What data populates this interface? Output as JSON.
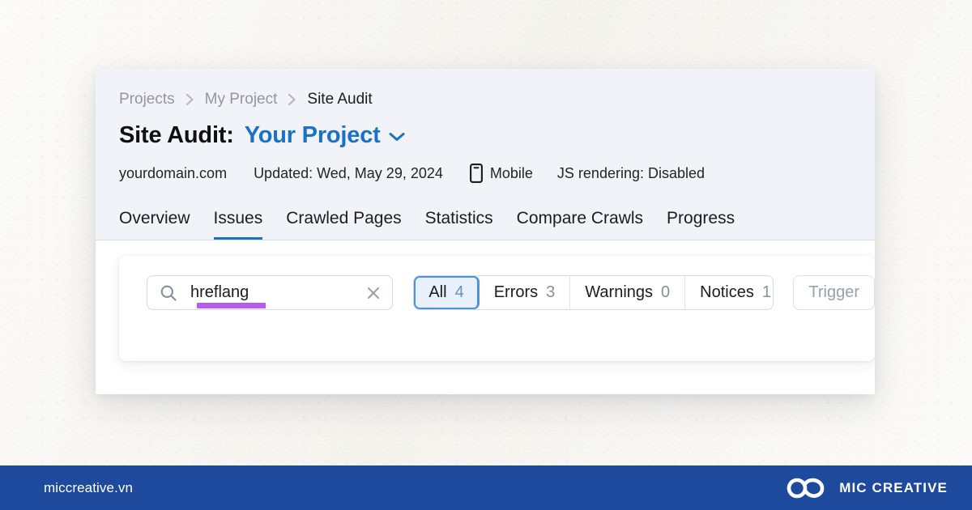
{
  "breadcrumb": {
    "items": [
      {
        "label": "Projects"
      },
      {
        "label": "My Project"
      },
      {
        "label": "Site Audit"
      }
    ],
    "separator_icon": "chevron-right-icon"
  },
  "header": {
    "title_static": "Site Audit:",
    "title_project": "Your Project",
    "project_dropdown_icon": "chevron-down-icon",
    "accent_blue": "#1a72c4"
  },
  "meta": {
    "domain": "yourdomain.com",
    "updated": "Updated: Wed, May 29, 2024",
    "device_icon": "mobile-phone-icon",
    "device": "Mobile",
    "js_rendering": "JS rendering: Disabled"
  },
  "tabs": [
    {
      "label": "Overview",
      "active": false
    },
    {
      "label": "Issues",
      "active": true
    },
    {
      "label": "Crawled Pages",
      "active": false
    },
    {
      "label": "Statistics",
      "active": false
    },
    {
      "label": "Compare Crawls",
      "active": false
    },
    {
      "label": "Progress",
      "active": false
    }
  ],
  "search": {
    "icon": "search-icon",
    "value": "hreflang",
    "placeholder": "Search",
    "clear_icon": "close-x-icon",
    "highlight_color": "#b85ce8"
  },
  "filters": {
    "segments": [
      {
        "label": "All",
        "count": "4",
        "active": true
      },
      {
        "label": "Errors",
        "count": "3",
        "active": false
      },
      {
        "label": "Warnings",
        "count": "0",
        "active": false
      },
      {
        "label": "Notices",
        "count": "1",
        "active": false
      }
    ],
    "trigger_button": "Trigger",
    "active_fill": "#e7f0fb",
    "active_border": "#4b93dd"
  },
  "footer": {
    "site": "miccreative.vn",
    "logo_icon": "infinity-loops-logo-icon",
    "brand": "MIC CREATIVE",
    "background": "#1e4a9e"
  }
}
